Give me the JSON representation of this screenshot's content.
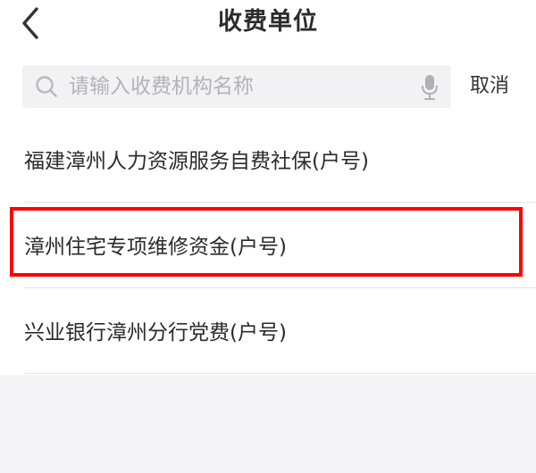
{
  "header": {
    "title": "收费单位"
  },
  "search": {
    "placeholder": "请输入收费机构名称",
    "value": "",
    "cancel_label": "取消"
  },
  "list": {
    "items": [
      {
        "label": "福建漳州人力资源服务自费社保(户号)"
      },
      {
        "label": "漳州住宅专项维修资金(户号)",
        "highlighted": true
      },
      {
        "label": "兴业银行漳州分行党费(户号)"
      }
    ]
  },
  "colors": {
    "highlight": "#ff0000",
    "background": "#ffffff",
    "search_background": "#f2f2f4",
    "footer_background": "#f4f4f6",
    "text": "#2b2b2b",
    "placeholder": "#b3b3b8"
  },
  "icons": {
    "back": "chevron-left-icon",
    "search": "search-icon",
    "voice": "microphone-icon"
  }
}
